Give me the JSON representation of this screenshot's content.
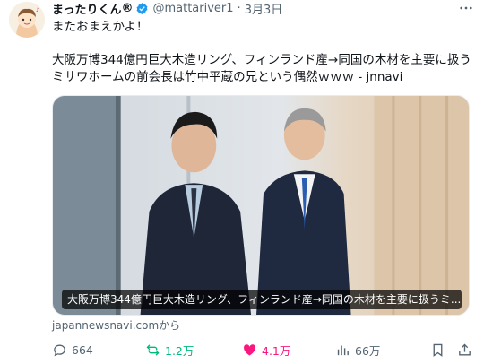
{
  "post": {
    "author_name": "まったりくん",
    "author_badge": "®",
    "handle": "@mattariver1",
    "separator": "·",
    "date": "3月3日",
    "text_line1": "またおまえかよ！",
    "text_body": "大阪万博344億円巨大木造リング、フィンランド産→同国の木材を主要に扱うミサワホームの前会長は竹中平蔵の兄という偶然ｗｗｗ - jnnavi"
  },
  "card": {
    "caption": "大阪万博344億円巨大木造リング、フィンランド産→同国の木材を主要に扱うミ...",
    "source": "japannewsnavi.comから"
  },
  "actions": {
    "replies": "664",
    "reposts": "1.2万",
    "likes": "4.1万",
    "views": "66万"
  },
  "colors": {
    "verified": "#1d9bf0",
    "repost": "#00ba7c",
    "like": "#f91880",
    "muted": "#536471"
  }
}
